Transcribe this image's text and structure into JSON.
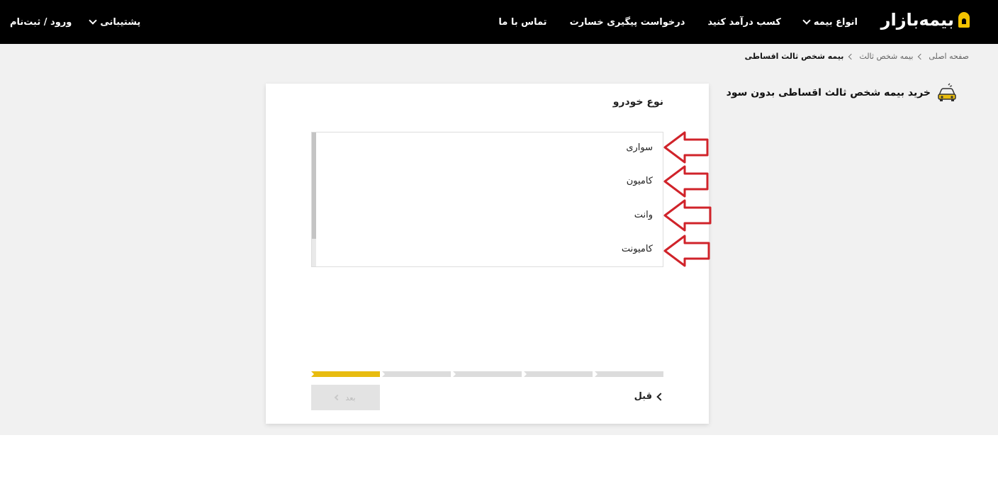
{
  "header": {
    "logo_text": "بیمه‌بازار",
    "nav": [
      "انواع بیمه",
      "کسب درآمد کنید",
      "درخواست پیگیری خسارت",
      "تماس با ما"
    ],
    "support": "پشتیبانی",
    "login": "ورود / ثبت‌نام"
  },
  "breadcrumb": {
    "home": "صفحه اصلی",
    "section": "بیمه شخص ثالث",
    "current": "بیمه شخص ثالث اقساطی"
  },
  "page": {
    "title": "خرید بیمه شخص ثالث اقساطی بدون سود"
  },
  "card": {
    "title": "نوع خودرو",
    "options": [
      "سواری",
      "کامیون",
      "وانت",
      "کامیونت"
    ],
    "progress_total_steps": 5,
    "progress_current_step": 1,
    "prev_label": "قبل",
    "next_label": "بعد"
  },
  "colors": {
    "accent": "#e8bc0f",
    "annotation_arrow": "#d0232a",
    "header_bg": "#000000"
  }
}
